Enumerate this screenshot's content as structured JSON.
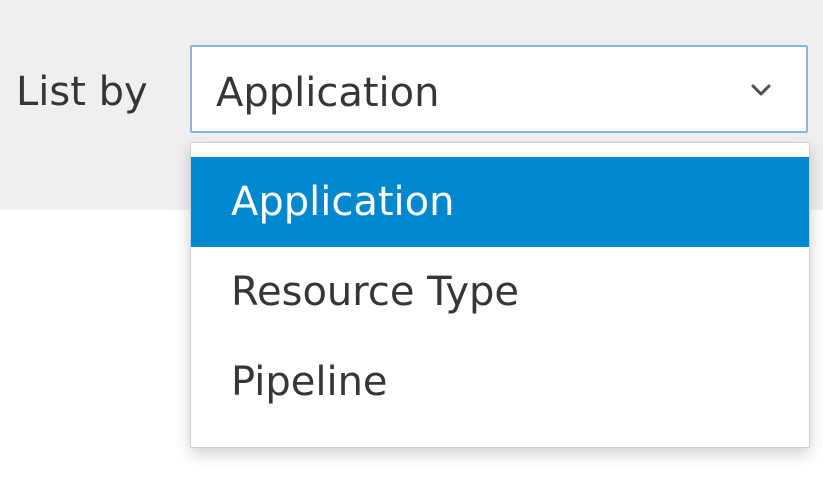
{
  "filter": {
    "label": "List by",
    "selected_value": "Application",
    "chevron_icon": "chevron-down-icon"
  },
  "dropdown": {
    "options": [
      {
        "label": "Application",
        "selected": true
      },
      {
        "label": "Resource Type",
        "selected": false
      },
      {
        "label": "Pipeline",
        "selected": false
      }
    ]
  },
  "colors": {
    "toolbar_bg": "#efefef",
    "select_border": "#83b9e0",
    "selected_bg": "#0088ce",
    "text": "#363636"
  }
}
